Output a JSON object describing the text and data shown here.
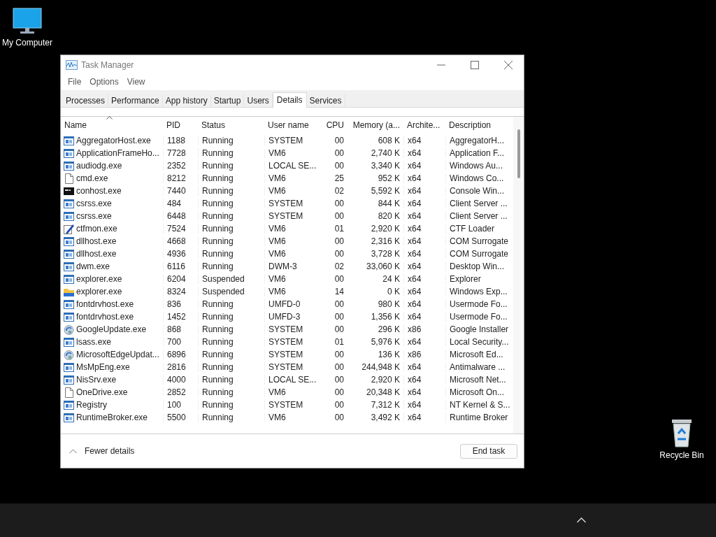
{
  "desktop_icons": [
    {
      "label": "My Computer",
      "kind": "computer"
    },
    {
      "label": "Recycle Bin",
      "kind": "bin"
    }
  ],
  "window": {
    "title": "Task Manager"
  },
  "menu": [
    "File",
    "Options",
    "View"
  ],
  "tabs": [
    {
      "label": "Processes",
      "selected": false
    },
    {
      "label": "Performance",
      "selected": false
    },
    {
      "label": "App history",
      "selected": false
    },
    {
      "label": "Startup",
      "selected": false
    },
    {
      "label": "Users",
      "selected": false
    },
    {
      "label": "Details",
      "selected": true
    },
    {
      "label": "Services",
      "selected": false
    }
  ],
  "table": {
    "columns": [
      "Name",
      "PID",
      "Status",
      "User name",
      "CPU",
      "Memory (a...",
      "Archite...",
      "Description"
    ],
    "rows": [
      {
        "kind": "app",
        "cells": [
          "AggregatorHost.exe",
          "1188",
          "Running",
          "SYSTEM",
          "00",
          "608 K",
          "x64",
          "AggregatorH..."
        ]
      },
      {
        "kind": "app",
        "cells": [
          "ApplicationFrameHo...",
          "7728",
          "Running",
          "VM6",
          "00",
          "2,740 K",
          "x64",
          "Application F..."
        ]
      },
      {
        "kind": "app",
        "cells": [
          "audiodg.exe",
          "2352",
          "Running",
          "LOCAL SE...",
          "00",
          "3,340 K",
          "x64",
          "Windows Au..."
        ]
      },
      {
        "kind": "file",
        "cells": [
          "cmd.exe",
          "8212",
          "Running",
          "VM6",
          "25",
          "952 K",
          "x64",
          "Windows Co..."
        ]
      },
      {
        "kind": "console",
        "cells": [
          "conhost.exe",
          "7440",
          "Running",
          "VM6",
          "02",
          "5,592 K",
          "x64",
          "Console Win..."
        ]
      },
      {
        "kind": "app",
        "cells": [
          "csrss.exe",
          "484",
          "Running",
          "SYSTEM",
          "00",
          "844 K",
          "x64",
          "Client Server ..."
        ]
      },
      {
        "kind": "app",
        "cells": [
          "csrss.exe",
          "6448",
          "Running",
          "SYSTEM",
          "00",
          "820 K",
          "x64",
          "Client Server ..."
        ]
      },
      {
        "kind": "pen",
        "cells": [
          "ctfmon.exe",
          "7524",
          "Running",
          "VM6",
          "01",
          "2,920 K",
          "x64",
          "CTF Loader"
        ]
      },
      {
        "kind": "app",
        "cells": [
          "dllhost.exe",
          "4668",
          "Running",
          "VM6",
          "00",
          "2,316 K",
          "x64",
          "COM Surrogate"
        ]
      },
      {
        "kind": "app",
        "cells": [
          "dllhost.exe",
          "4936",
          "Running",
          "VM6",
          "00",
          "3,728 K",
          "x64",
          "COM Surrogate"
        ]
      },
      {
        "kind": "app",
        "cells": [
          "dwm.exe",
          "6116",
          "Running",
          "DWM-3",
          "02",
          "33,060 K",
          "x64",
          "Desktop Win..."
        ]
      },
      {
        "kind": "app",
        "cells": [
          "explorer.exe",
          "6204",
          "Suspended",
          "VM6",
          "00",
          "24 K",
          "x64",
          "Explorer"
        ]
      },
      {
        "kind": "folder",
        "cells": [
          "explorer.exe",
          "8324",
          "Suspended",
          "VM6",
          "14",
          "0 K",
          "x64",
          "Windows Exp..."
        ]
      },
      {
        "kind": "app",
        "cells": [
          "fontdrvhost.exe",
          "836",
          "Running",
          "UMFD-0",
          "00",
          "980 K",
          "x64",
          "Usermode Fo..."
        ]
      },
      {
        "kind": "app",
        "cells": [
          "fontdrvhost.exe",
          "1452",
          "Running",
          "UMFD-3",
          "00",
          "1,356 K",
          "x64",
          "Usermode Fo..."
        ]
      },
      {
        "kind": "installer",
        "cells": [
          "GoogleUpdate.exe",
          "868",
          "Running",
          "SYSTEM",
          "00",
          "296 K",
          "x86",
          "Google Installer"
        ]
      },
      {
        "kind": "app",
        "cells": [
          "lsass.exe",
          "700",
          "Running",
          "SYSTEM",
          "01",
          "5,976 K",
          "x64",
          "Local Security..."
        ]
      },
      {
        "kind": "installer",
        "cells": [
          "MicrosoftEdgeUpdat...",
          "6896",
          "Running",
          "SYSTEM",
          "00",
          "136 K",
          "x86",
          "Microsoft Ed..."
        ]
      },
      {
        "kind": "app",
        "cells": [
          "MsMpEng.exe",
          "2816",
          "Running",
          "SYSTEM",
          "00",
          "244,948 K",
          "x64",
          "Antimalware ..."
        ]
      },
      {
        "kind": "app",
        "cells": [
          "NisSrv.exe",
          "4000",
          "Running",
          "LOCAL SE...",
          "00",
          "2,920 K",
          "x64",
          "Microsoft Net..."
        ]
      },
      {
        "kind": "file",
        "cells": [
          "OneDrive.exe",
          "2852",
          "Running",
          "VM6",
          "00",
          "20,348 K",
          "x64",
          "Microsoft On..."
        ]
      },
      {
        "kind": "app",
        "cells": [
          "Registry",
          "100",
          "Running",
          "SYSTEM",
          "00",
          "7,312 K",
          "x64",
          "NT Kernel & S..."
        ]
      },
      {
        "kind": "app",
        "cells": [
          "RuntimeBroker.exe",
          "5500",
          "Running",
          "VM6",
          "00",
          "3,492 K",
          "x64",
          "Runtime Broker"
        ]
      }
    ]
  },
  "footer": {
    "toggle": "Fewer details",
    "button": "End task"
  }
}
